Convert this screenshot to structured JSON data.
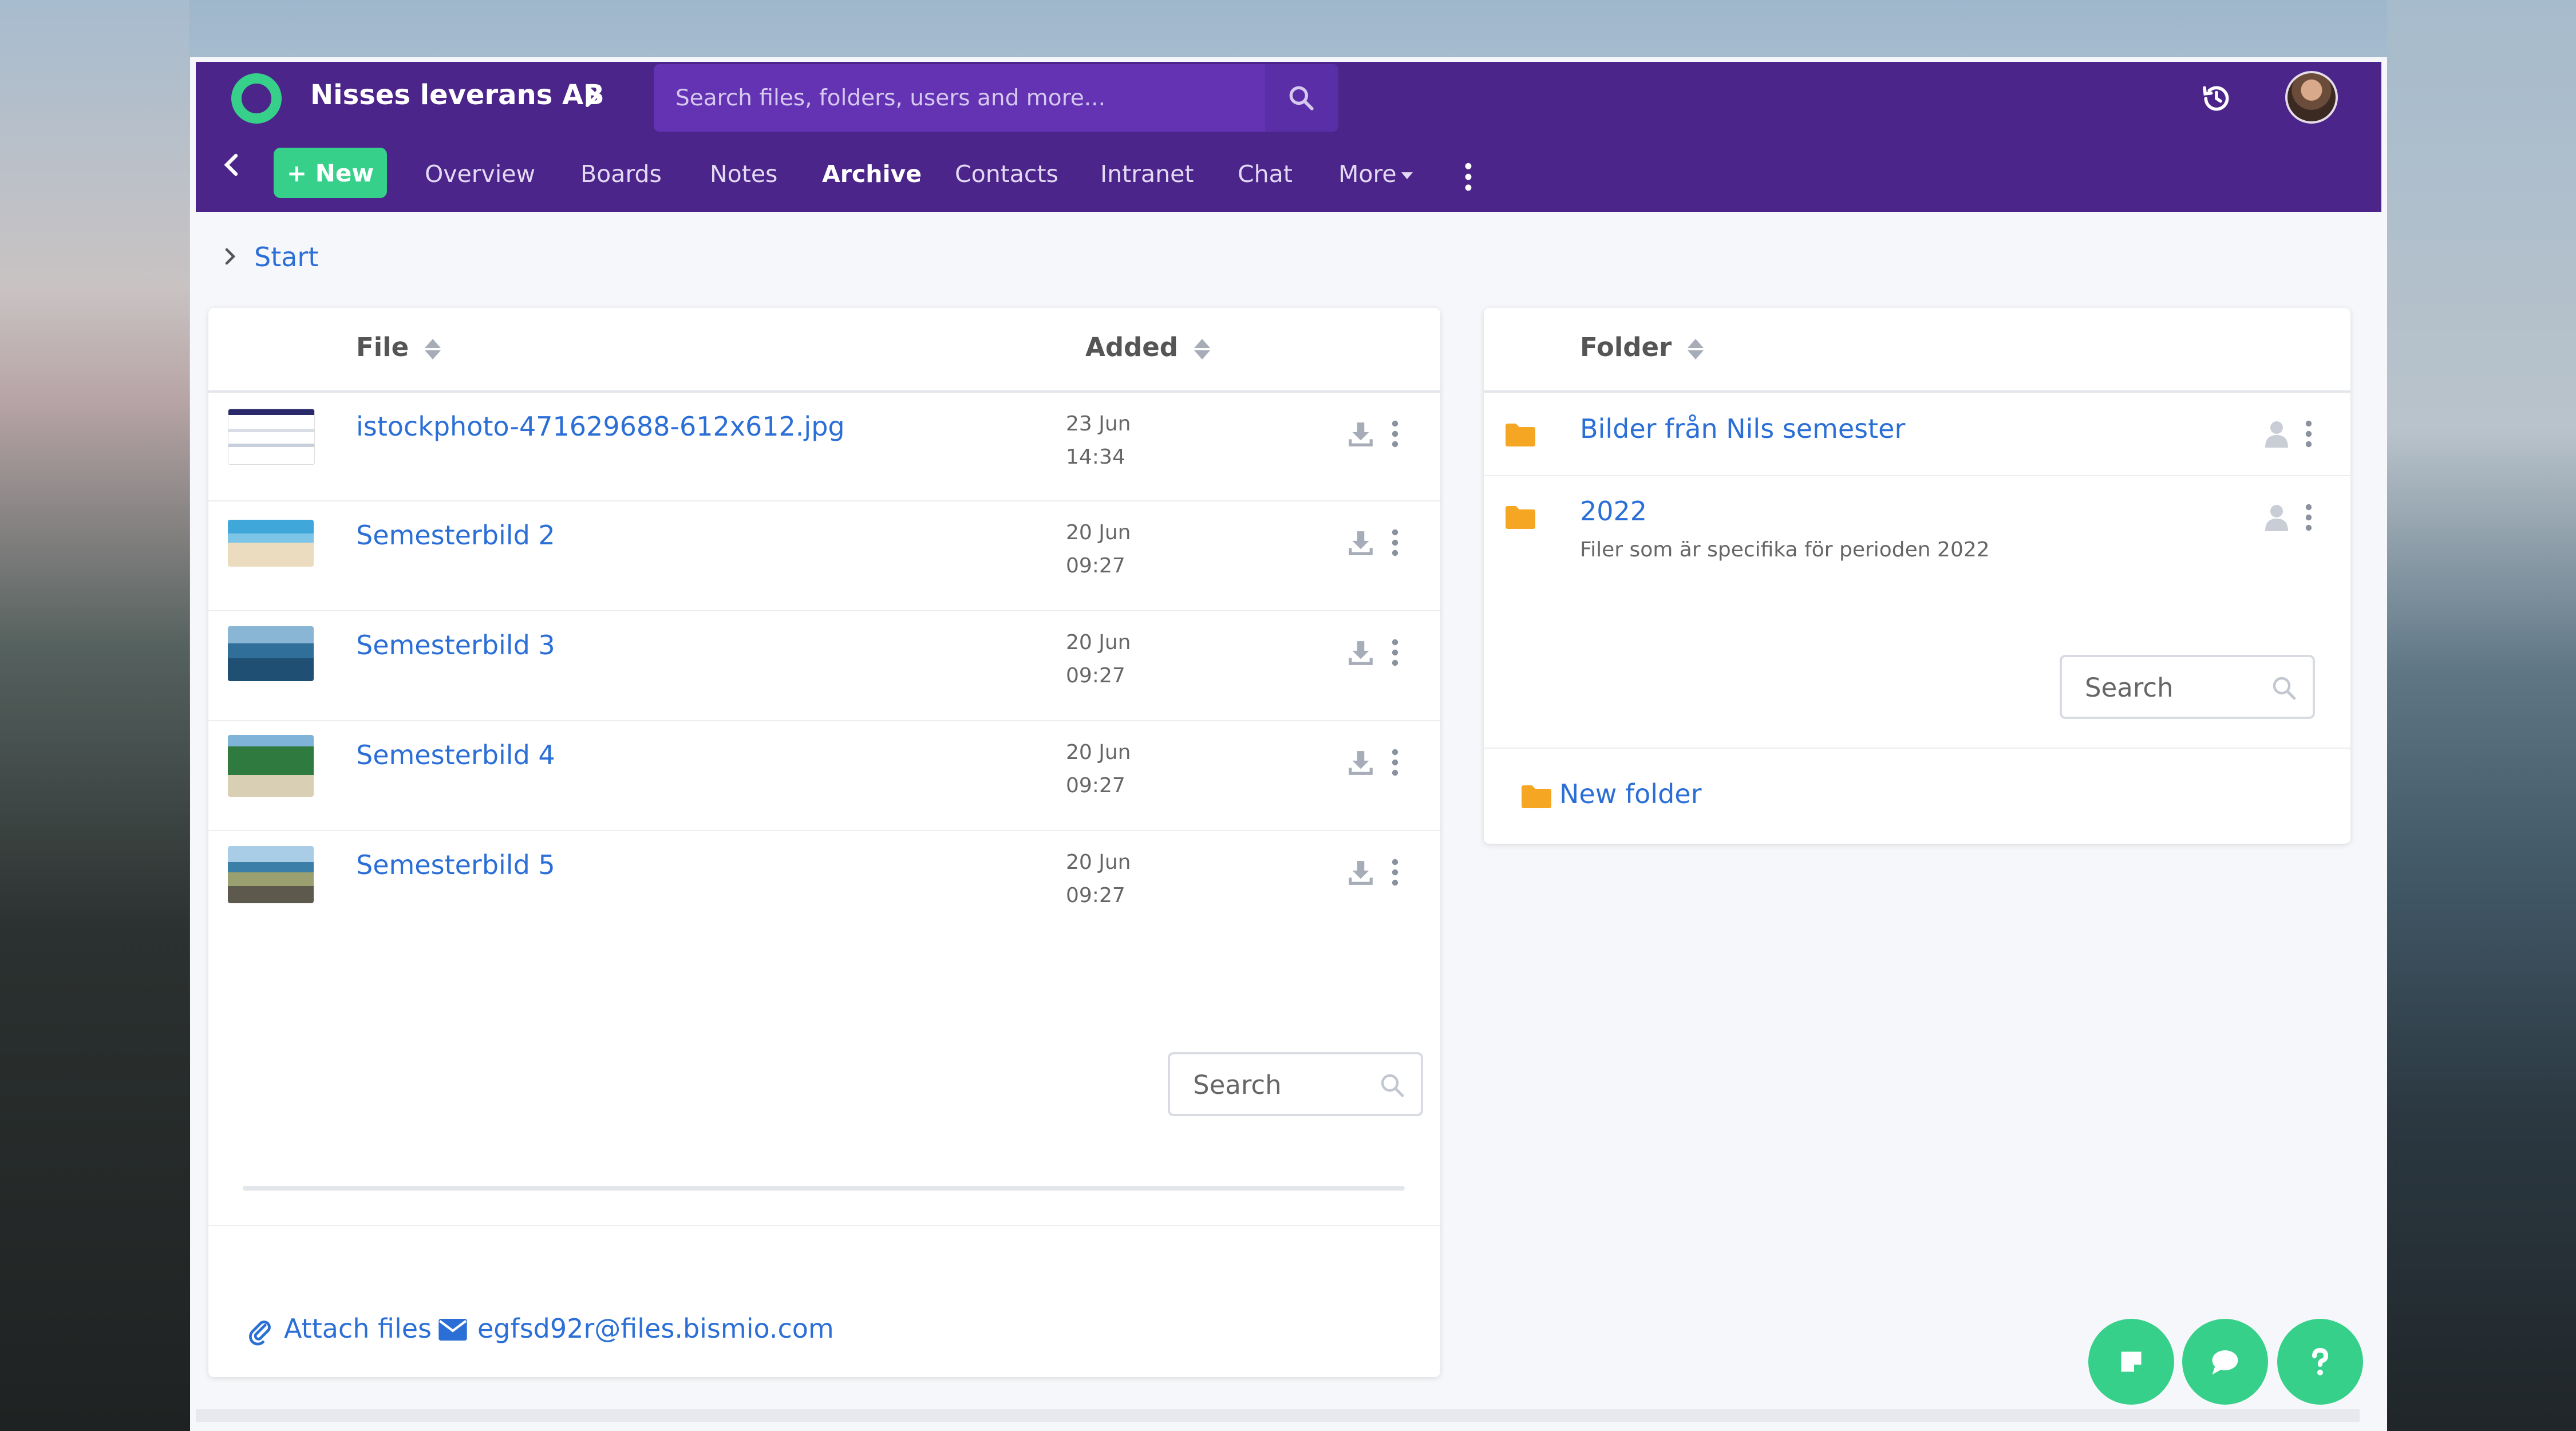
{
  "topbar": {
    "company": "Nisses leverans AB",
    "search_placeholder": "Search files, folders, users and more...",
    "brand_color": "#4b2589",
    "accent_color": "#37d08a"
  },
  "nav": {
    "new_label": "+ New",
    "items": [
      "Overview",
      "Boards",
      "Notes",
      "Archive",
      "Contacts",
      "Intranet",
      "Chat",
      "More"
    ],
    "active": "Archive"
  },
  "breadcrumb": {
    "label": "Start"
  },
  "files": {
    "headers": {
      "file": "File",
      "added": "Added"
    },
    "rows": [
      {
        "name": "istockphoto-471629688-612x612.jpg",
        "date": "23 Jun",
        "time": "14:34"
      },
      {
        "name": "Semesterbild 2",
        "date": "20 Jun",
        "time": "09:27"
      },
      {
        "name": "Semesterbild 3",
        "date": "20 Jun",
        "time": "09:27"
      },
      {
        "name": "Semesterbild 4",
        "date": "20 Jun",
        "time": "09:27"
      },
      {
        "name": "Semesterbild 5",
        "date": "20 Jun",
        "time": "09:27"
      }
    ],
    "search_placeholder": "Search",
    "attach_label": "Attach files",
    "email": "egfsd92r@files.bismio.com"
  },
  "folders": {
    "header": "Folder",
    "rows": [
      {
        "name": "Bilder från Nils semester",
        "desc": ""
      },
      {
        "name": "2022",
        "desc": "Filer som är specifika för perioden 2022"
      }
    ],
    "search_placeholder": "Search",
    "new_folder_label": "New folder",
    "folder_color": "#f5a623"
  },
  "icons": [
    "logo-icon",
    "chevron-right-icon",
    "search-icon",
    "history-icon",
    "avatar",
    "back-icon",
    "caret-down-icon",
    "kebab-icon",
    "sort-icon",
    "download-icon",
    "folder-icon",
    "person-icon",
    "paperclip-icon",
    "mail-icon",
    "note-icon",
    "chat-icon",
    "help-icon"
  ]
}
